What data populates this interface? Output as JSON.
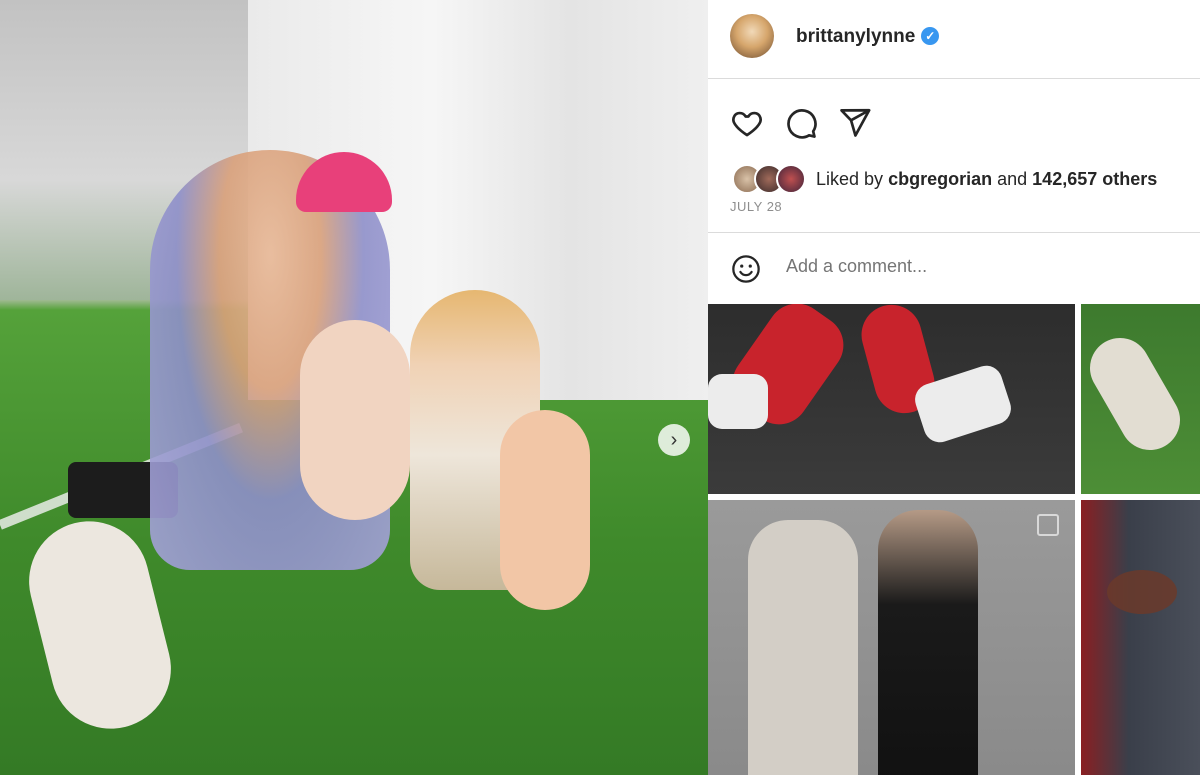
{
  "post": {
    "username": "brittanylynne",
    "verified": true,
    "likes": {
      "prefix": "Liked by",
      "user": "cbgregorian",
      "and": "and",
      "count_text": "142,657 others"
    },
    "date": "JULY 28",
    "comment_placeholder": "Add a comment..."
  },
  "icons": {
    "like": "heart-icon",
    "comment": "comment-icon",
    "share": "send-icon",
    "emoji": "emoji-icon",
    "next": "chevron-right-icon",
    "verified": "verified-badge-icon"
  },
  "colors": {
    "verified_blue": "#3897f0",
    "text": "#262626",
    "muted": "#8e8e8e",
    "border": "#dbdbdb"
  }
}
